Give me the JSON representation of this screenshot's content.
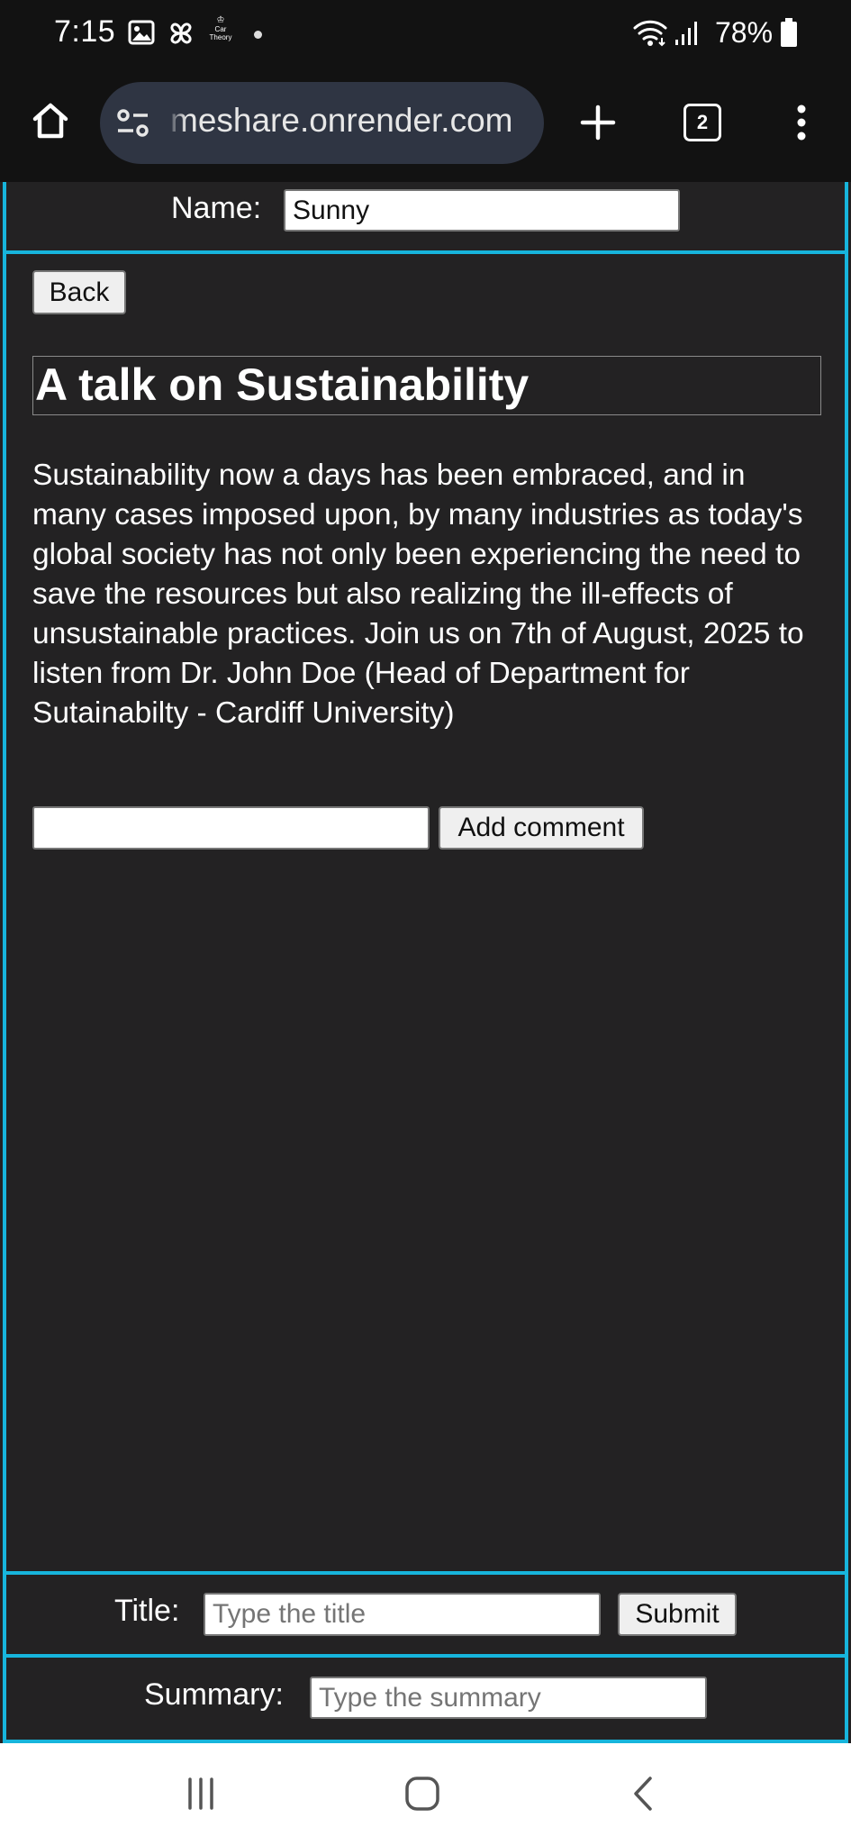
{
  "status_bar": {
    "time": "7:15",
    "notification_icons": [
      "image-icon",
      "pinwheel-icon",
      "car-theory-icon"
    ],
    "car_theory_label_top": "Car",
    "car_theory_label_bottom": "Theory",
    "battery": "78%"
  },
  "browser": {
    "url": "meshare.onrender.com",
    "tab_count": "2"
  },
  "page": {
    "name_label": "Name:",
    "name_value": "Sunny",
    "back_label": "Back",
    "post_title": "A talk on Sustainability",
    "post_body": "Sustainability now a days has been embraced, and in many cases imposed upon, by many industries as today's global society has not only been experiencing the need to save the resources but also realizing the ill-effects of unsustainable practices. Join us on 7th of August, 2025 to listen from Dr. John Doe (Head of Department for Sutainabilty - Cardiff University)",
    "comment_value": "",
    "add_comment_label": "Add comment",
    "title_label": "Title:",
    "title_placeholder": "Type the title",
    "submit_label": "Submit",
    "summary_label": "Summary:",
    "summary_placeholder": "Type the summary"
  },
  "colors": {
    "frame_border": "#17b5dc",
    "page_background": "#232223",
    "browser_chrome": "#121212",
    "url_pill": "#2f3543"
  }
}
